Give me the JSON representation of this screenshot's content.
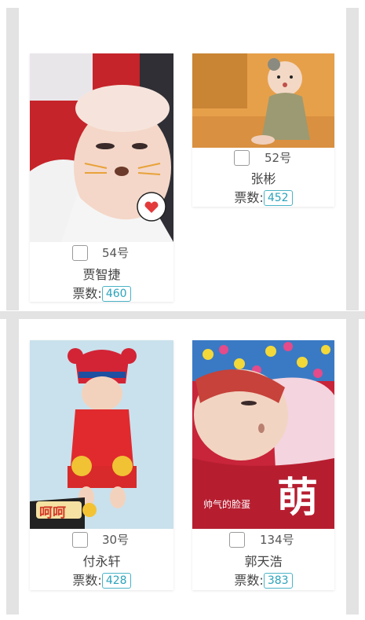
{
  "colors": {
    "accent": "#2aa3bb",
    "rail": "#e3e3e3"
  },
  "entries": [
    {
      "number": "54号",
      "name": "贾智捷",
      "votes_label": "票数:",
      "votes": "460",
      "photo_overlay_text": ""
    },
    {
      "number": "52号",
      "name": "张彬",
      "votes_label": "票数:",
      "votes": "452",
      "photo_overlay_text": ""
    },
    {
      "number": "30号",
      "name": "付永轩",
      "votes_label": "票数:",
      "votes": "428",
      "photo_overlay_text": "呵呵"
    },
    {
      "number": "134号",
      "name": "郭天浩",
      "votes_label": "票数:",
      "votes": "383",
      "photo_overlay_text": "萌",
      "photo_caption": "帅气的脸蛋"
    }
  ]
}
